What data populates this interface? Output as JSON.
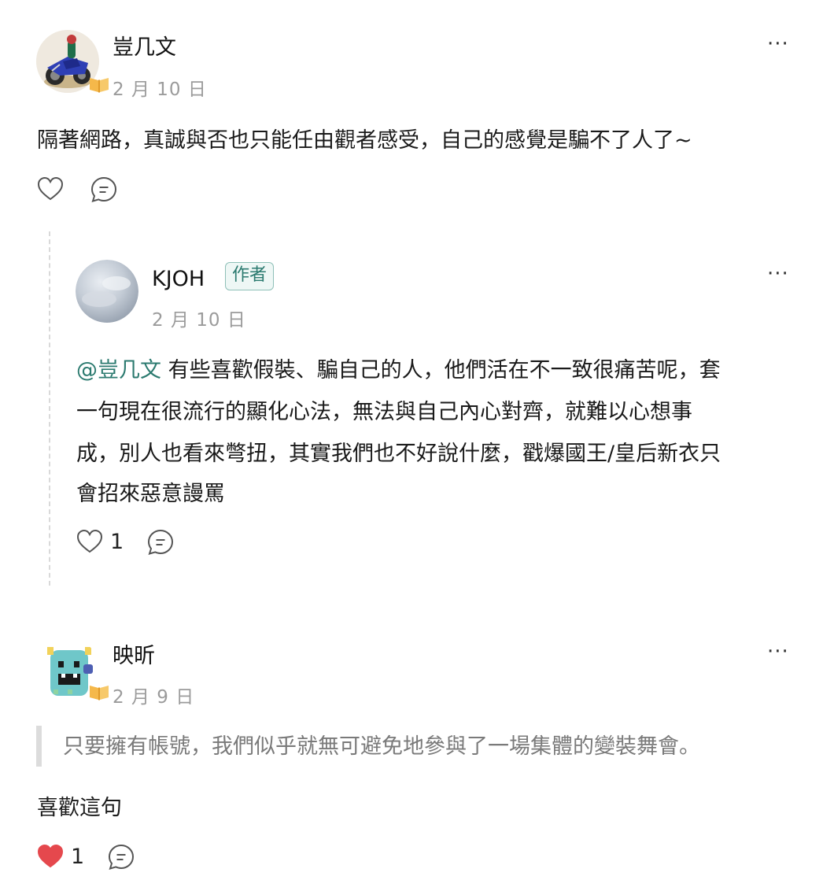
{
  "comments": [
    {
      "username": "豈几文",
      "date": "2 月 10 日",
      "text": "隔著網路，真誠與否也只能任由觀者感受，自己的感覺是騙不了人了~",
      "likes": "",
      "more": "···"
    },
    {
      "username": "KJOH",
      "author_tag": "作者",
      "date": "2 月 10 日",
      "mention": "@豈几文",
      "text_lines": [
        " 有些喜歡假裝、騙自己的人，他們活在不一致很痛苦呢，套",
        "一句現在很流行的顯化心法，無法與自己內心對齊，就難以心想事",
        "成，別人也看來彆扭，其實我們也不好說什麼，戳爆國王/皇后新衣只",
        "會招來惡意謾罵"
      ],
      "likes": "1",
      "more": "···"
    },
    {
      "username": "映昕",
      "date": "2 月 9 日",
      "quote": "只要擁有帳號，我們似乎就無可避免地參與了一場集體的變裝舞會。",
      "text": "喜歡這句",
      "likes": "1",
      "more": "···"
    }
  ],
  "colors": {
    "mention": "#2b7a6f",
    "author_tag_border": "#8fc0b8",
    "liked_heart": "#e5484d",
    "date": "#9b9b9b"
  },
  "icons": [
    "heart-outline-icon",
    "comment-bubble-icon",
    "heart-filled-icon",
    "book-badge-icon",
    "more-dots-icon"
  ]
}
